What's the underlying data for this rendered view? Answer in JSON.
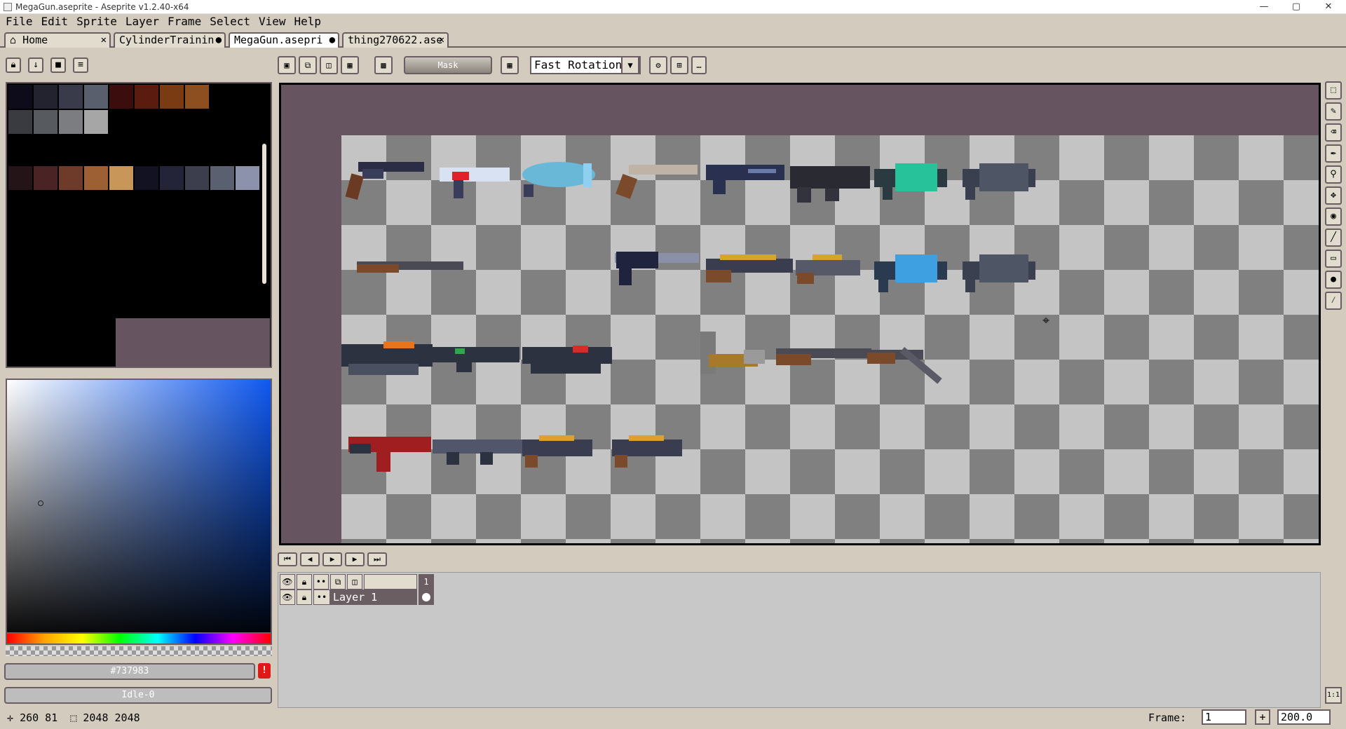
{
  "window": {
    "title": "MegaGun.aseprite - Aseprite v1.2.40-x64",
    "minimize": "—",
    "maximize": "▢",
    "close": "✕"
  },
  "menu": [
    "File",
    "Edit",
    "Sprite",
    "Layer",
    "Frame",
    "Select",
    "View",
    "Help"
  ],
  "tabs": [
    {
      "label": "Home",
      "icon": "home-icon",
      "marker": "✕"
    },
    {
      "label": "CylinderTrainin",
      "marker": "●"
    },
    {
      "label": "MegaGun.asepri",
      "marker": "●"
    },
    {
      "label": "thing270622.ase",
      "marker": "✕"
    }
  ],
  "context_bar": {
    "mask_label": "Mask",
    "rotation_algorithm": "Fast Rotation"
  },
  "color": {
    "hex": "#737983",
    "tag": "Idle-0",
    "warning": "!"
  },
  "palette": {
    "row1": [
      "#0e0b1a",
      "#23222f",
      "#3a3b4a",
      "#5a5f6e",
      "#3b0d0d",
      "#5b1b0e",
      "#7a3a12",
      "#8e4f20"
    ],
    "row2": [
      "#3a3b40",
      "#575a5f",
      "#7b7d80",
      "#a6a6a6"
    ],
    "row3": [
      "#241418",
      "#4a2424",
      "#6e3a2a",
      "#9c6034",
      "#c89658",
      "#121222",
      "#232438",
      "#3c3e4e",
      "#5b6070",
      "#8c91ac"
    ]
  },
  "timeline": {
    "layer_name": "Layer 1",
    "frame_header": "1"
  },
  "status": {
    "position": "260 81",
    "size": "2048 2048",
    "frame_label": "Frame:",
    "frame_value": "1",
    "zoom": "200.0",
    "zoom_fit": "1:1"
  }
}
